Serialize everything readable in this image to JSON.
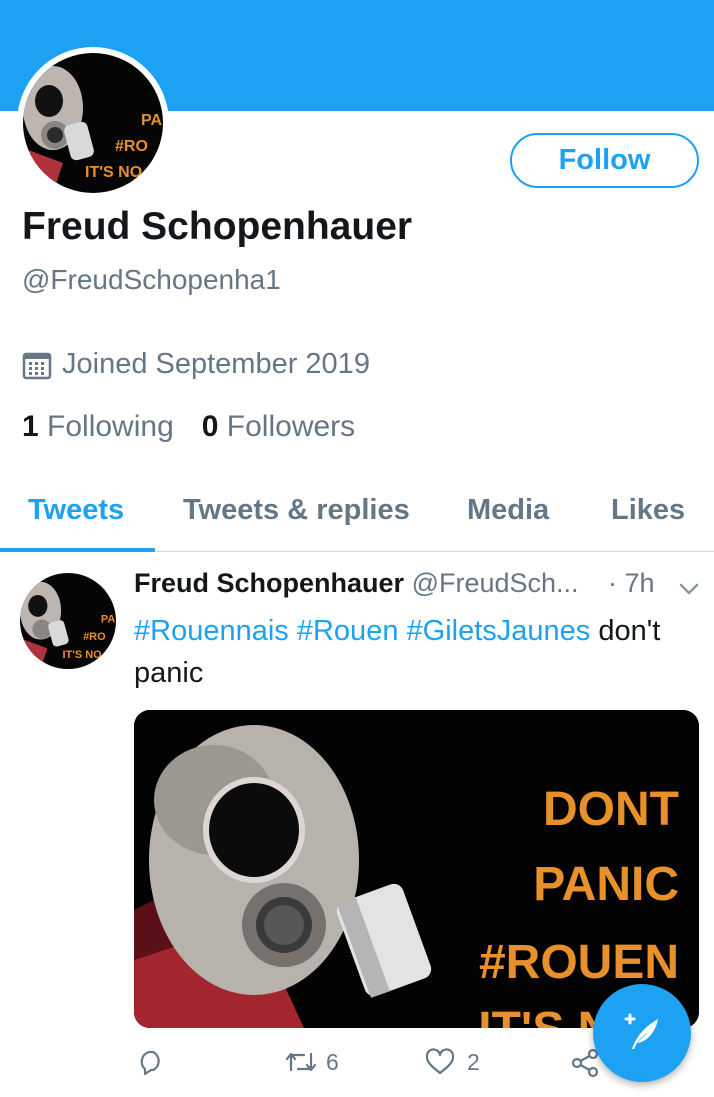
{
  "profile": {
    "display_name": "Freud Schopenhauer",
    "handle": "@FreudSchopenha1",
    "joined": "Joined September 2019",
    "following_count": "1",
    "following_label": "Following",
    "followers_count": "0",
    "followers_label": "Followers",
    "follow_button": "Follow"
  },
  "avatar_art": {
    "lines": [
      "PA",
      "#RO",
      "IT'S NO"
    ]
  },
  "tabs": [
    {
      "label": "Tweets",
      "active": true
    },
    {
      "label": "Tweets & replies",
      "active": false
    },
    {
      "label": "Media",
      "active": false
    },
    {
      "label": "Likes",
      "active": false
    }
  ],
  "tweet": {
    "name": "Freud Schopenhauer",
    "handle": "@FreudSch...",
    "time": "· 7h",
    "hashtags": [
      "#Rouennais",
      "#Rouen",
      "#GiletsJaunes"
    ],
    "text_rest": "don't",
    "text_line2": "panic",
    "media_text": [
      "DONT",
      "PANIC",
      "#ROUEN",
      "IT'S NOT"
    ],
    "retweets": "6",
    "likes": "2"
  },
  "colors": {
    "accent": "#1da1f2",
    "text_primary": "#14171a",
    "text_secondary": "#657786",
    "poster_orange": "#e8902a"
  },
  "icons": [
    "calendar-icon",
    "caret-down-icon",
    "reply-icon",
    "retweet-icon",
    "like-icon",
    "share-icon",
    "compose-feather-icon"
  ]
}
